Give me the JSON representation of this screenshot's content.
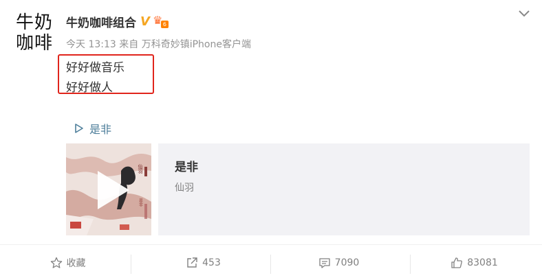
{
  "post": {
    "avatar_lines": [
      "牛奶",
      "咖啡"
    ],
    "author": "牛奶咖啡组合",
    "verified_badge": "V",
    "time": "今天 13:13",
    "source": "来自 万科奇妙镇iPhone客户端",
    "content_lines": [
      "好好做音乐",
      "好好做人"
    ],
    "song_link": "是非",
    "highlight_color": "#e0241b",
    "link_color": "#4d7e9a"
  },
  "music_card": {
    "title": "是非",
    "artist": "仙羽",
    "cover_text_1": "仙羽",
    "cover_text_2": "是非"
  },
  "actions": {
    "favorite_label": "收藏",
    "repost_count": "453",
    "comment_count": "7090",
    "like_count": "83081"
  },
  "icons": [
    "chevron-down-icon",
    "verified-icon",
    "member-icon",
    "play-outline-icon",
    "play-icon",
    "star-icon",
    "share-icon",
    "comment-icon",
    "like-icon"
  ]
}
